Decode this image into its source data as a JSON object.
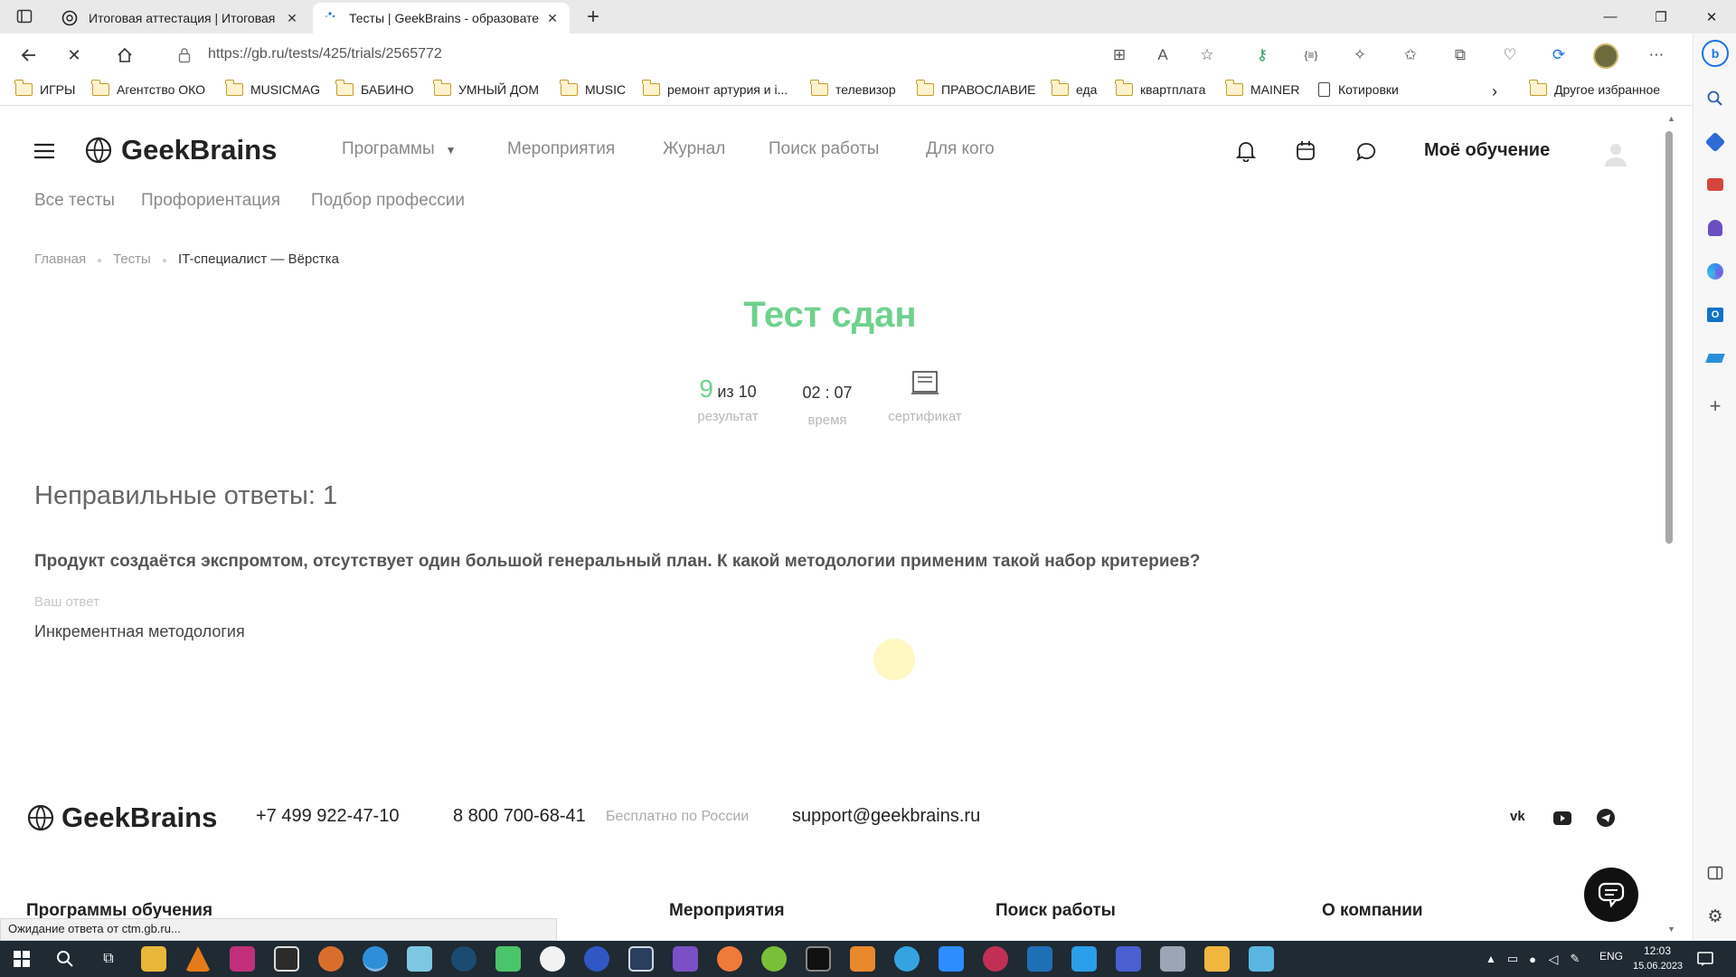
{
  "browser": {
    "tabs": [
      {
        "title": "Итоговая аттестация | Итоговая"
      },
      {
        "title": "Тесты | GeekBrains - образовате"
      }
    ],
    "url": "https://gb.ru/tests/425/trials/2565772",
    "favorites": [
      "ИГРЫ",
      "Агентство ОКО",
      "MUSICMAG",
      "БАБИНО",
      "УМНЫЙ ДОМ",
      "MUSIC",
      "ремонт артурия и i...",
      "телевизор",
      "ПРАВОСЛАВИЕ",
      "еда",
      "квартплата",
      "MAINER",
      "Котировки"
    ],
    "other_favorites": "Другое избранное",
    "status_text": "Ожидание ответа от ctm.gb.ru..."
  },
  "site": {
    "logo": "GeekBrains",
    "nav": [
      "Программы",
      "Мероприятия",
      "Журнал",
      "Поиск работы",
      "Для кого"
    ],
    "my_learning": "Моё обучение",
    "subnav": [
      "Все тесты",
      "Профориентация",
      "Подбор профессии"
    ],
    "breadcrumbs": [
      "Главная",
      "Тесты",
      "IT-специалист — Вёрстка"
    ]
  },
  "result": {
    "title": "Тест сдан",
    "score": "9",
    "score_of": "из 10",
    "score_label": "результат",
    "time": "02 : 07",
    "time_label": "время",
    "cert_label": "сертификат"
  },
  "wrong": {
    "heading": "Неправильные ответы: 1",
    "question": "Продукт создаётся экспромтом, отсутствует один большой генеральный план. К какой методологии применим такой набор критериев?",
    "your_answer_label": "Ваш ответ",
    "answer": "Инкрементная методология"
  },
  "footer": {
    "logo": "GeekBrains",
    "phone1": "+7 499 922-47-10",
    "phone2": "8 800 700-68-41",
    "free_note": "Бесплатно по России",
    "email": "support@geekbrains.ru",
    "columns": [
      "Программы обучения",
      "Мероприятия",
      "Поиск работы",
      "О компании"
    ]
  },
  "taskbar": {
    "lang": "ENG",
    "time": "12:03",
    "date": "15.06.2023"
  },
  "colors": {
    "success": "#6fd18e",
    "muted": "#8a8a8a"
  }
}
